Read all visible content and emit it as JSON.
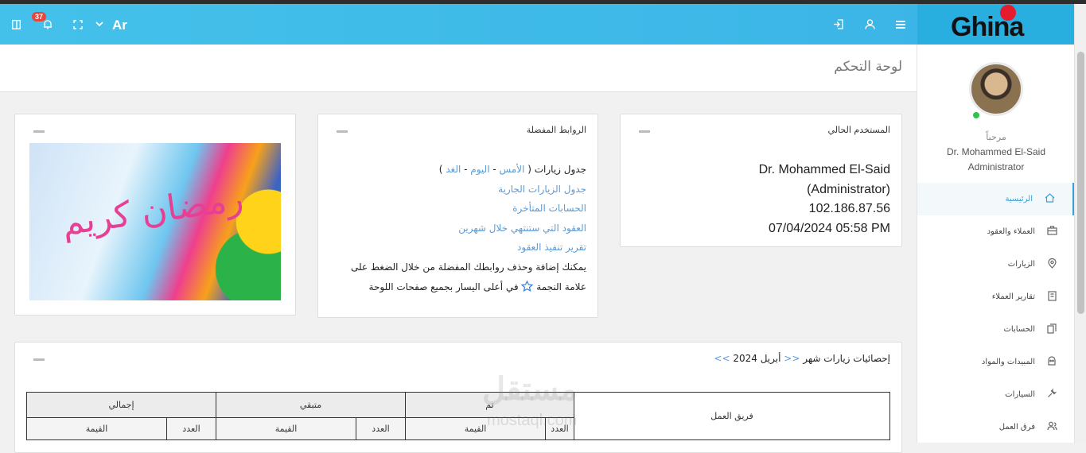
{
  "topbar": {
    "notifications_count": "37",
    "language": "Ar",
    "brand": "Ghina"
  },
  "sidebar": {
    "welcome": "مرحباً",
    "user_name": "Dr. Mohammed El-Said",
    "user_role": "Administrator",
    "items": [
      {
        "label": "الرئيسية",
        "icon": "home-icon"
      },
      {
        "label": "العملاء والعقود",
        "icon": "briefcase-icon"
      },
      {
        "label": "الزيارات",
        "icon": "map-pin-icon"
      },
      {
        "label": "تقارير العملاء",
        "icon": "report-icon"
      },
      {
        "label": "الحسابات",
        "icon": "documents-icon"
      },
      {
        "label": "المبيدات والمواد",
        "icon": "box-icon"
      },
      {
        "label": "السيارات",
        "icon": "wrench-icon"
      },
      {
        "label": "فرق العمل",
        "icon": "team-icon"
      }
    ]
  },
  "page": {
    "title": "لوحة التحكم"
  },
  "current_user_panel": {
    "title": "المستخدم الحالي",
    "name": "Dr. Mohammed El-Said",
    "role": "(Administrator)",
    "ip": "102.186.87.56",
    "datetime": "07/04/2024 05:58 PM"
  },
  "favorites_panel": {
    "title": "الروابط المفضلة",
    "visits_prefix": "جدول زيارات (",
    "yesterday": "الأمس",
    "sep1": " - ",
    "today": "اليوم",
    "sep2": " - ",
    "tomorrow": "الغد",
    "visits_suffix": " )",
    "link_current_visits": "جدول الزيارات الجارية",
    "link_late_accounts": "الحسابات المتأخرة",
    "link_expiring_contracts": "العقود التي ستنتهي خلال شهرين",
    "link_contracts_report": "تقرير تنفيذ العقود",
    "hint_1": "يمكنك إضافة وحذف روابطك المفضلة من خلال الضغط على",
    "hint_2a": "علامة النجمة",
    "hint_2b": "في أعلى اليسار بجميع صفحات اللوحة"
  },
  "banner": {
    "text": "رمضان كريم"
  },
  "stats_panel": {
    "title": "إحصائيات زيارات شهر",
    "prev": "<<",
    "month": "أبريل 2024",
    "next": ">>",
    "headers": {
      "team": "فريق العمل",
      "done": "تم",
      "remaining": "متبقي",
      "total": "إجمالي",
      "count": "العدد",
      "value": "القيمة"
    }
  },
  "watermark": {
    "ar": "مستقل",
    "en": "mostaql.com"
  }
}
